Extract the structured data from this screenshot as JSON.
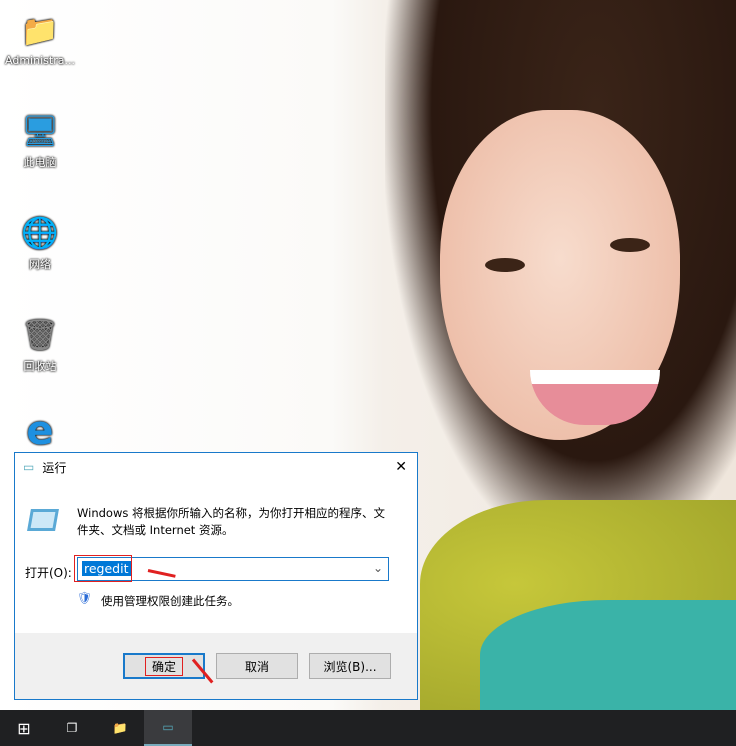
{
  "desktop": {
    "icons": [
      {
        "label": "Administra..."
      },
      {
        "label": "此电脑"
      },
      {
        "label": "网络"
      },
      {
        "label": "回收站"
      }
    ]
  },
  "dialog": {
    "title": "运行",
    "description": "Windows 将根据你所输入的名称，为你打开相应的程序、文件夹、文档或 Internet 资源。",
    "open_label": "打开(O):",
    "input_value": "regedit",
    "admin_note": "使用管理权限创建此任务。",
    "ok": "确定",
    "cancel": "取消",
    "browse": "浏览(B)...",
    "close": "✕"
  },
  "colors": {
    "accent": "#1979ca",
    "annotation": "#e02020"
  }
}
